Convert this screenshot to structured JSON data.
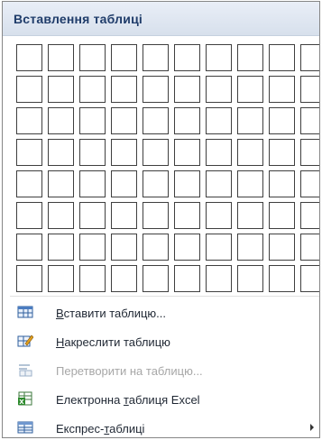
{
  "header": {
    "title": "Вставлення таблиці"
  },
  "grid": {
    "columns": 10,
    "rows": 8
  },
  "menu_items": [
    {
      "id": "insert-table",
      "icon": "table-icon",
      "pre": "",
      "accel": "В",
      "post": "ставити таблицю...",
      "disabled": false,
      "submenu": false
    },
    {
      "id": "draw-table",
      "icon": "pencil-table-icon",
      "pre": "",
      "accel": "Н",
      "post": "акреслити таблицю",
      "disabled": false,
      "submenu": false
    },
    {
      "id": "convert-to-table",
      "icon": "convert-text-icon",
      "pre": "",
      "accel": "",
      "post": "Перетворити на таблицю...",
      "disabled": true,
      "submenu": false
    },
    {
      "id": "excel-spreadsheet",
      "icon": "excel-sheet-icon",
      "pre": "Електронна ",
      "accel": "т",
      "post": "аблиця Excel",
      "disabled": false,
      "submenu": false
    },
    {
      "id": "quick-tables",
      "icon": "quick-tables-icon",
      "pre": "Експрес-",
      "accel": "т",
      "post": "аблиці",
      "disabled": false,
      "submenu": true
    }
  ]
}
